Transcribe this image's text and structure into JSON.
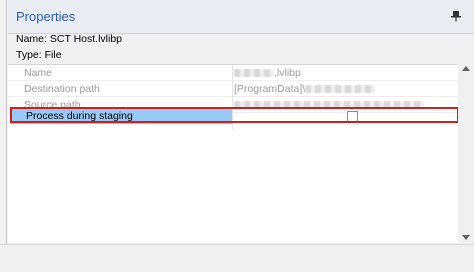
{
  "panel": {
    "title": "Properties"
  },
  "info": {
    "name_label": "Name:",
    "name_value": "SCT Host.lvlibp",
    "type_label": "Type:",
    "type_value": "File"
  },
  "rows": [
    {
      "label": "Name",
      "value_visible": ".lvlibp"
    },
    {
      "label": "Destination path",
      "value_visible": "[ProgramData]\\"
    },
    {
      "label": "Source path",
      "value_visible": ""
    },
    {
      "label": "Process during staging",
      "checked": false
    }
  ],
  "colors": {
    "title": "#2a5db0",
    "selection": "#99c9f5",
    "highlight_border": "#d01e1e"
  }
}
